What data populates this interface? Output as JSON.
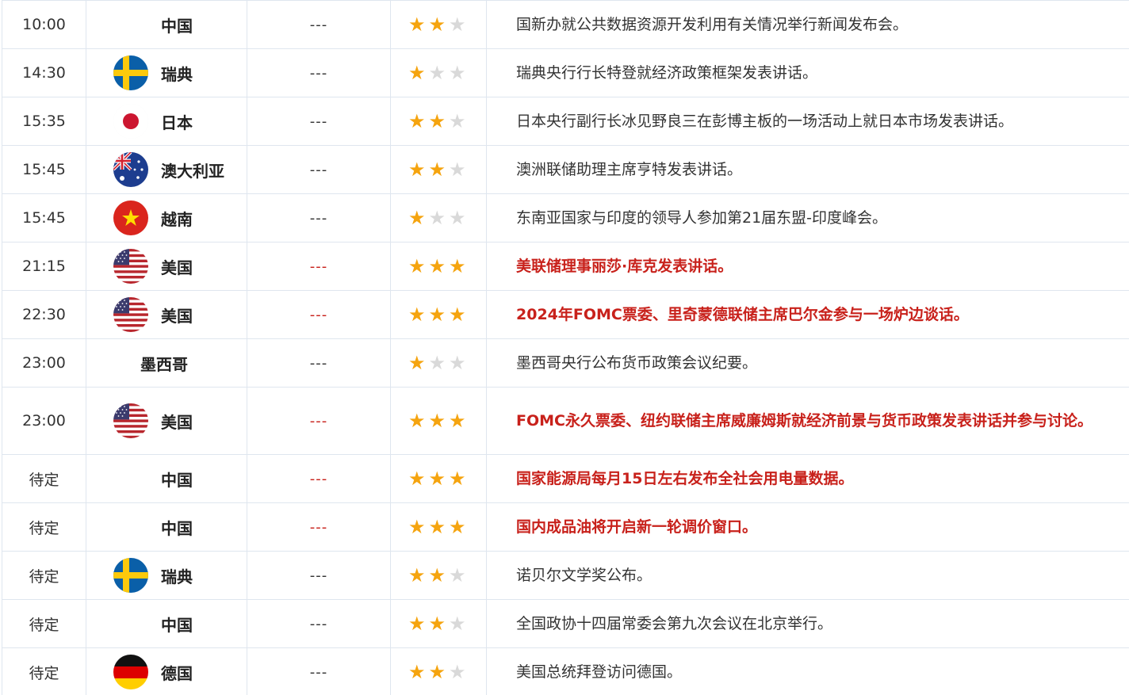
{
  "colors": {
    "accent_red": "#c8211b",
    "star_on": "#f5a40f",
    "star_off": "#d9d9d9",
    "border": "#dfe6ef"
  },
  "rows": [
    {
      "time": "10:00",
      "flag": "none",
      "country": "中国",
      "actual": "---",
      "stars": 2,
      "event": "国新办就公共数据资源开发利用有关情况举行新闻发布会。",
      "hot": false,
      "h": 61
    },
    {
      "time": "14:30",
      "flag": "sweden-flag-icon",
      "country": "瑞典",
      "actual": "---",
      "stars": 1,
      "event": "瑞典央行行长特登就经济政策框架发表讲话。",
      "hot": false,
      "h": 61
    },
    {
      "time": "15:35",
      "flag": "japan-flag-icon",
      "country": "日本",
      "actual": "---",
      "stars": 2,
      "event": "日本央行副行长冰见野良三在彭博主板的一场活动上就日本市场发表讲话。",
      "hot": false,
      "h": 61
    },
    {
      "time": "15:45",
      "flag": "australia-flag-icon",
      "country": "澳大利亚",
      "actual": "---",
      "stars": 2,
      "event": "澳洲联储助理主席亨特发表讲话。",
      "hot": false,
      "h": 61
    },
    {
      "time": "15:45",
      "flag": "vietnam-flag-icon",
      "country": "越南",
      "actual": "---",
      "stars": 1,
      "event": "东南亚国家与印度的领导人参加第21届东盟-印度峰会。",
      "hot": false,
      "h": 61
    },
    {
      "time": "21:15",
      "flag": "usa-flag-icon",
      "country": "美国",
      "actual": "---",
      "stars": 3,
      "event": "美联储理事丽莎·库克发表讲话。",
      "hot": true,
      "h": 61
    },
    {
      "time": "22:30",
      "flag": "usa-flag-icon",
      "country": "美国",
      "actual": "---",
      "stars": 3,
      "event": "2024年FOMC票委、里奇蒙德联储主席巴尔金参与一场炉边谈话。",
      "hot": true,
      "h": 61
    },
    {
      "time": "23:00",
      "flag": "none-wide",
      "country": "墨西哥",
      "actual": "---",
      "stars": 1,
      "event": "墨西哥央行公布货币政策会议纪要。",
      "hot": false,
      "h": 61
    },
    {
      "time": "23:00",
      "flag": "usa-flag-icon",
      "country": "美国",
      "actual": "---",
      "stars": 3,
      "event": "FOMC永久票委、纽约联储主席威廉姆斯就经济前景与货币政策发表讲话并参与讨论。",
      "hot": true,
      "h": 85
    },
    {
      "time": "待定",
      "flag": "none",
      "country": "中国",
      "actual": "---",
      "stars": 3,
      "event": "国家能源局每月15日左右发布全社会用电量数据。",
      "hot": true,
      "h": 61
    },
    {
      "time": "待定",
      "flag": "none",
      "country": "中国",
      "actual": "---",
      "stars": 3,
      "event": "国内成品油将开启新一轮调价窗口。",
      "hot": true,
      "h": 61
    },
    {
      "time": "待定",
      "flag": "sweden-flag-icon",
      "country": "瑞典",
      "actual": "---",
      "stars": 2,
      "event": "诺贝尔文学奖公布。",
      "hot": false,
      "h": 61
    },
    {
      "time": "待定",
      "flag": "none",
      "country": "中国",
      "actual": "---",
      "stars": 2,
      "event": "全国政协十四届常委会第九次会议在北京举行。",
      "hot": false,
      "h": 61
    },
    {
      "time": "待定",
      "flag": "germany-flag-icon",
      "country": "德国",
      "actual": "---",
      "stars": 2,
      "event": "美国总统拜登访问德国。",
      "hot": false,
      "h": 61
    }
  ]
}
